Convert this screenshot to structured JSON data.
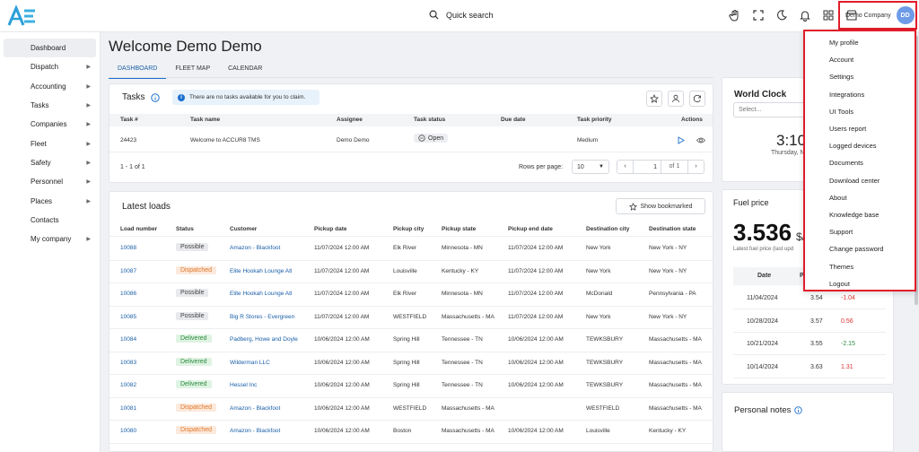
{
  "header": {
    "search_label": "Quick search",
    "company": "Demo Company",
    "avatar_initials": "DD"
  },
  "sidebar": {
    "items": [
      {
        "label": "Dashboard",
        "icon": "chart-icon",
        "arrow": false
      },
      {
        "label": "Dispatch",
        "icon": "send-icon",
        "arrow": true
      },
      {
        "label": "Accounting",
        "icon": "dollar-icon",
        "arrow": true
      },
      {
        "label": "Tasks",
        "icon": "clipboard-icon",
        "arrow": true
      },
      {
        "label": "Companies",
        "icon": "building-icon",
        "arrow": true
      },
      {
        "label": "Fleet",
        "icon": "truck-icon",
        "arrow": true
      },
      {
        "label": "Safety",
        "icon": "shield-icon",
        "arrow": true
      },
      {
        "label": "Personnel",
        "icon": "id-card-icon",
        "arrow": true
      },
      {
        "label": "Places",
        "icon": "places-icon",
        "arrow": true
      },
      {
        "label": "Contacts",
        "icon": "phone-icon",
        "arrow": false
      },
      {
        "label": "My company",
        "icon": "home-icon",
        "arrow": true
      }
    ]
  },
  "page": {
    "title": "Welcome Demo Demo",
    "tabs": [
      "DASHBOARD",
      "FLEET MAP",
      "CALENDAR"
    ]
  },
  "tasks": {
    "title": "Tasks",
    "banner": "There are no tasks available for you to claim.",
    "columns": [
      "Task #",
      "Task name",
      "Assignee",
      "Task status",
      "Due date",
      "Task priority",
      "Actions"
    ],
    "rows": [
      {
        "num": "24423",
        "name": "Welcome to ACCUR8 TMS",
        "assignee": "Demo Demo",
        "status": "Open",
        "due": "",
        "priority": "Medium"
      }
    ],
    "range": "1 - 1 of 1",
    "rows_per_page_label": "Rows per page:",
    "rows_per_page": "10",
    "page": "1",
    "of_pages": "of 1"
  },
  "loads": {
    "title": "Latest loads",
    "show_bookmarked": "Show bookmarked",
    "columns": [
      "Load number",
      "Status",
      "Customer",
      "Pickup date",
      "Pickup city",
      "Pickup state",
      "Pickup end date",
      "Destination city",
      "Destination state"
    ],
    "rows": [
      {
        "num": "10088",
        "status": "Possible",
        "customer": "Amazon - Blackfoot",
        "pdate": "11/07/2024 12:00 AM",
        "pcity": "Elk River",
        "pstate": "Minnesota - MN",
        "pend": "11/07/2024 12:00 AM",
        "dcity": "New York",
        "dstate": "New York - NY"
      },
      {
        "num": "10087",
        "status": "Dispatched",
        "customer": "Elite Hookah Lounge Atl",
        "pdate": "11/07/2024 12:00 AM",
        "pcity": "Louisville",
        "pstate": "Kentucky - KY",
        "pend": "11/07/2024 12:00 AM",
        "dcity": "New York",
        "dstate": "New York - NY"
      },
      {
        "num": "10086",
        "status": "Possible",
        "customer": "Elite Hookah Lounge Atl",
        "pdate": "11/07/2024 12:00 AM",
        "pcity": "Elk River",
        "pstate": "Minnesota - MN",
        "pend": "11/07/2024 12:00 AM",
        "dcity": "McDonald",
        "dstate": "Pennsylvania - PA"
      },
      {
        "num": "10085",
        "status": "Possible",
        "customer": "Big R Stores - Evergreen",
        "pdate": "11/07/2024 12:00 AM",
        "pcity": "WESTFIELD",
        "pstate": "Massachusetts - MA",
        "pend": "11/07/2024 12:00 AM",
        "dcity": "New York",
        "dstate": "New York - NY"
      },
      {
        "num": "10084",
        "status": "Delivered",
        "customer": "Padberg, Howe and Doyle",
        "pdate": "10/06/2024 12:00 AM",
        "pcity": "Spring Hill",
        "pstate": "Tennessee - TN",
        "pend": "10/06/2024 12:00 AM",
        "dcity": "TEWKSBURY",
        "dstate": "Massachusetts - MA"
      },
      {
        "num": "10083",
        "status": "Delivered",
        "customer": "Wilderman LLC",
        "pdate": "10/06/2024 12:00 AM",
        "pcity": "Spring Hill",
        "pstate": "Tennessee - TN",
        "pend": "10/06/2024 12:00 AM",
        "dcity": "TEWKSBURY",
        "dstate": "Massachusetts - MA"
      },
      {
        "num": "10082",
        "status": "Delivered",
        "customer": "Hessel Inc",
        "pdate": "10/06/2024 12:00 AM",
        "pcity": "Spring Hill",
        "pstate": "Tennessee - TN",
        "pend": "10/06/2024 12:00 AM",
        "dcity": "TEWKSBURY",
        "dstate": "Massachusetts - MA"
      },
      {
        "num": "10081",
        "status": "Dispatched",
        "customer": "Amazon - Blackfoot",
        "pdate": "10/06/2024 12:00 AM",
        "pcity": "WESTFIELD",
        "pstate": "Massachusetts - MA",
        "pend": "",
        "dcity": "WESTFIELD",
        "dstate": "Massachusetts - MA"
      },
      {
        "num": "10080",
        "status": "Dispatched",
        "customer": "Amazon - Blackfoot",
        "pdate": "10/06/2024 12:00 AM",
        "pcity": "Boston",
        "pstate": "Massachusetts - MA",
        "pend": "10/06/2024 12:00 AM",
        "dcity": "Louisville",
        "dstate": "Kentucky - KY"
      }
    ]
  },
  "world_clock": {
    "title": "World Clock",
    "select_placeholder": "Select...",
    "time": "3:10",
    "day": "Thursday, N"
  },
  "fuel": {
    "title": "Fuel price",
    "price": "3.536",
    "unit": "$/",
    "sub": "Latest fuel price (last upd",
    "col_date": "Date",
    "col_price": "P",
    "rows": [
      {
        "date": "11/04/2024",
        "price": "3.54",
        "change": "-1.04",
        "sign": "neg"
      },
      {
        "date": "10/28/2024",
        "price": "3.57",
        "change": "0.56",
        "sign": "neg"
      },
      {
        "date": "10/21/2024",
        "price": "3.55",
        "change": "-2.15",
        "sign": "pos"
      },
      {
        "date": "10/14/2024",
        "price": "3.63",
        "change": "1.31",
        "sign": "neg"
      }
    ]
  },
  "notes": {
    "title": "Personal notes"
  },
  "menu": {
    "items": [
      {
        "label": "My profile",
        "icon": "user-circle-icon"
      },
      {
        "label": "Account",
        "icon": "building-icon"
      },
      {
        "label": "Settings",
        "icon": "gear-icon"
      },
      {
        "label": "Integrations",
        "icon": "puzzle-icon"
      },
      {
        "label": "UI Tools",
        "icon": "tools-icon"
      },
      {
        "label": "Users report",
        "icon": "users-icon"
      },
      {
        "label": "Logged devices",
        "icon": "device-icon"
      },
      {
        "label": "Documents",
        "icon": "documents-icon"
      },
      {
        "label": "Download center",
        "icon": "download-icon"
      },
      {
        "label": "About",
        "icon": "info-icon"
      },
      {
        "label": "Knowledge base",
        "icon": "graduation-icon"
      },
      {
        "label": "Support",
        "icon": "support-icon"
      },
      {
        "label": "Change password",
        "icon": "lock-icon"
      },
      {
        "label": "Themes",
        "icon": "themes-icon"
      },
      {
        "label": "Logout",
        "icon": "logout-icon"
      }
    ]
  }
}
